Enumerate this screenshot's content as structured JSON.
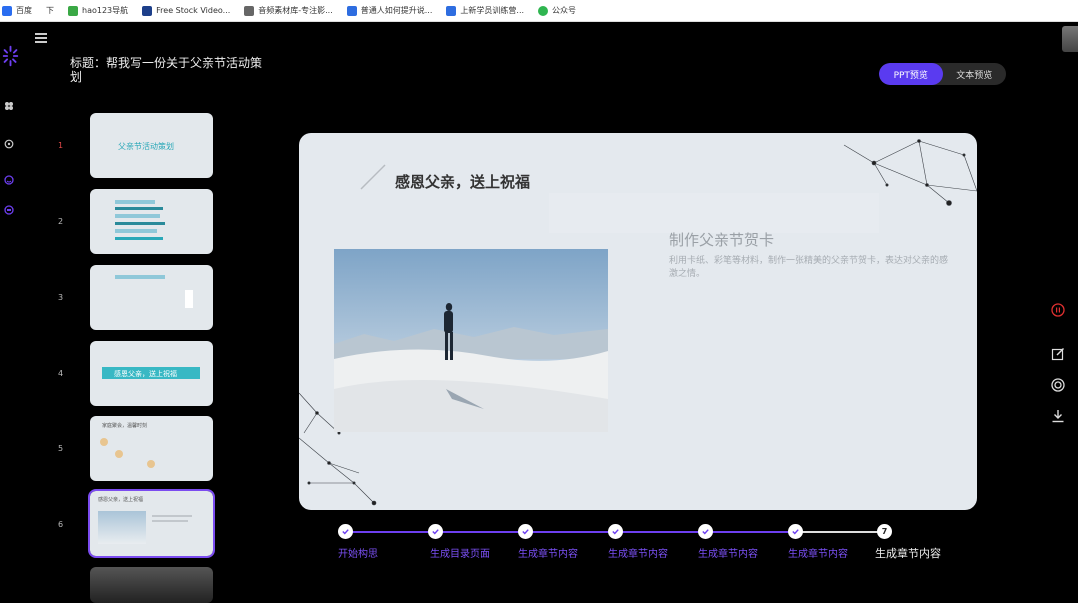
{
  "bookmarks": [
    {
      "label": "百度",
      "color": "#2a6df0"
    },
    {
      "label": "下",
      "color": "#ffffff"
    },
    {
      "label": "hao123导航",
      "color": "#3aa845"
    },
    {
      "label": "Free Stock Video...",
      "color": "#1d3f8a"
    },
    {
      "label": "音频素材库-专注影...",
      "color": "#555"
    },
    {
      "label": "普通人如何提升说...",
      "color": "#2e6de0"
    },
    {
      "label": "上新学员训练营...",
      "color": "#2e6de0"
    },
    {
      "label": "公众号",
      "color": "#2fb550"
    }
  ],
  "header": {
    "title": "标题：帮我写一份关于父亲节活动策划",
    "toggle": {
      "ppt": "PPT预览",
      "text": "文本预览"
    }
  },
  "thumbnails": [
    {
      "num": "1",
      "title": "父亲节活动策划"
    },
    {
      "num": "2",
      "title": ""
    },
    {
      "num": "3",
      "title": ""
    },
    {
      "num": "4",
      "title": "感恩父亲，送上祝福"
    },
    {
      "num": "5",
      "title": "家庭聚会，温馨时刻"
    },
    {
      "num": "6",
      "title": "感恩父亲，送上祝福"
    }
  ],
  "slide": {
    "heading": "感恩父亲，送上祝福",
    "subheading": "制作父亲节贺卡",
    "body": "利用卡纸、彩笔等材料，制作一张精美的父亲节贺卡，表达对父亲的感激之情。"
  },
  "steps": [
    {
      "label": "开始构思"
    },
    {
      "label": "生成目录页面"
    },
    {
      "label": "生成章节内容"
    },
    {
      "label": "生成章节内容"
    },
    {
      "label": "生成章节内容"
    },
    {
      "label": "生成章节内容"
    },
    {
      "label": "生成章节内容",
      "num": "7"
    }
  ]
}
